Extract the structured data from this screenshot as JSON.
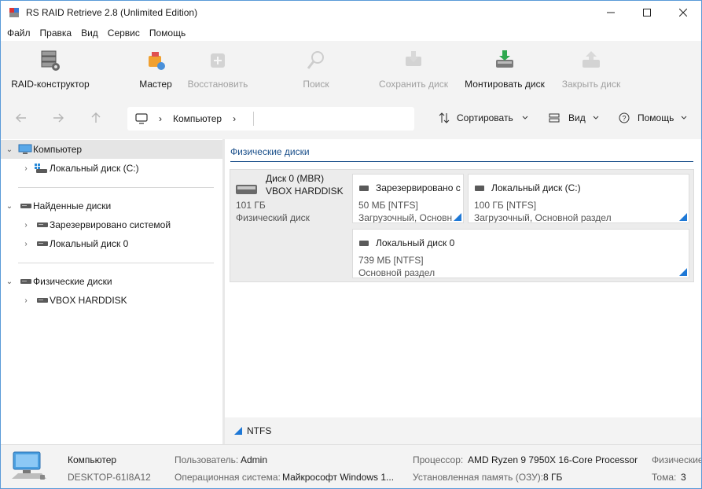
{
  "window": {
    "title": "RS RAID Retrieve 2.8 (Unlimited Edition)",
    "minimize_icon": "minimize-icon",
    "maximize_icon": "maximize-icon",
    "close_icon": "close-icon"
  },
  "menu": [
    "Файл",
    "Правка",
    "Вид",
    "Сервис",
    "Помощь"
  ],
  "toolbar": {
    "raid": "RAID-конструктор",
    "wizard": "Мастер",
    "restore": "Восстановить",
    "search": "Поиск",
    "save_disk": "Сохранить диск",
    "mount_disk": "Монтировать диск",
    "close_disk": "Закрыть диск"
  },
  "nav": {
    "breadcrumb": "Компьютер",
    "sort": "Сортировать",
    "view": "Вид",
    "help": "Помощь"
  },
  "tree": {
    "computer": "Компьютер",
    "local_c": "Локальный диск (C:)",
    "found": "Найденные диски",
    "reserved": "Зарезервировано системой",
    "local0": "Локальный диск 0",
    "physical": "Физические диски",
    "vbox": "VBOX HARDDISK"
  },
  "content": {
    "section_title": "Физические диски",
    "disk": {
      "name": "Диск 0 (MBR)",
      "model": "VBOX HARDDISK",
      "size": "101 ГБ",
      "type": "Физический диск"
    },
    "partitions": [
      {
        "name": "Зарезервировано с",
        "size": "50 МБ [NTFS]",
        "type": "Загрузочный, Основн"
      },
      {
        "name": "Локальный диск (C:)",
        "size": "100 ГБ [NTFS]",
        "type": "Загрузочный, Основной раздел"
      },
      {
        "name": "Локальный диск 0",
        "size": "739 МБ [NTFS]",
        "type": "Основной раздел"
      }
    ],
    "fs_legend": "NTFS",
    "accent": "#1e78d6"
  },
  "status": {
    "computer_label": "Компьютер",
    "computer_name": "DESKTOP-61I8A12",
    "user_label": "Пользователь:",
    "user_value": "Admin",
    "os_label": "Операционная система:",
    "os_value": "Майкрософт Windows 1...",
    "cpu_label": "Процессор:",
    "cpu_value": "AMD Ryzen 9 7950X 16-Core Processor",
    "ram_label": "Установленная память (ОЗУ):",
    "ram_value": "8 ГБ",
    "phys_label": "Физические",
    "volumes_label": "Тома:",
    "volumes_value": "3"
  }
}
